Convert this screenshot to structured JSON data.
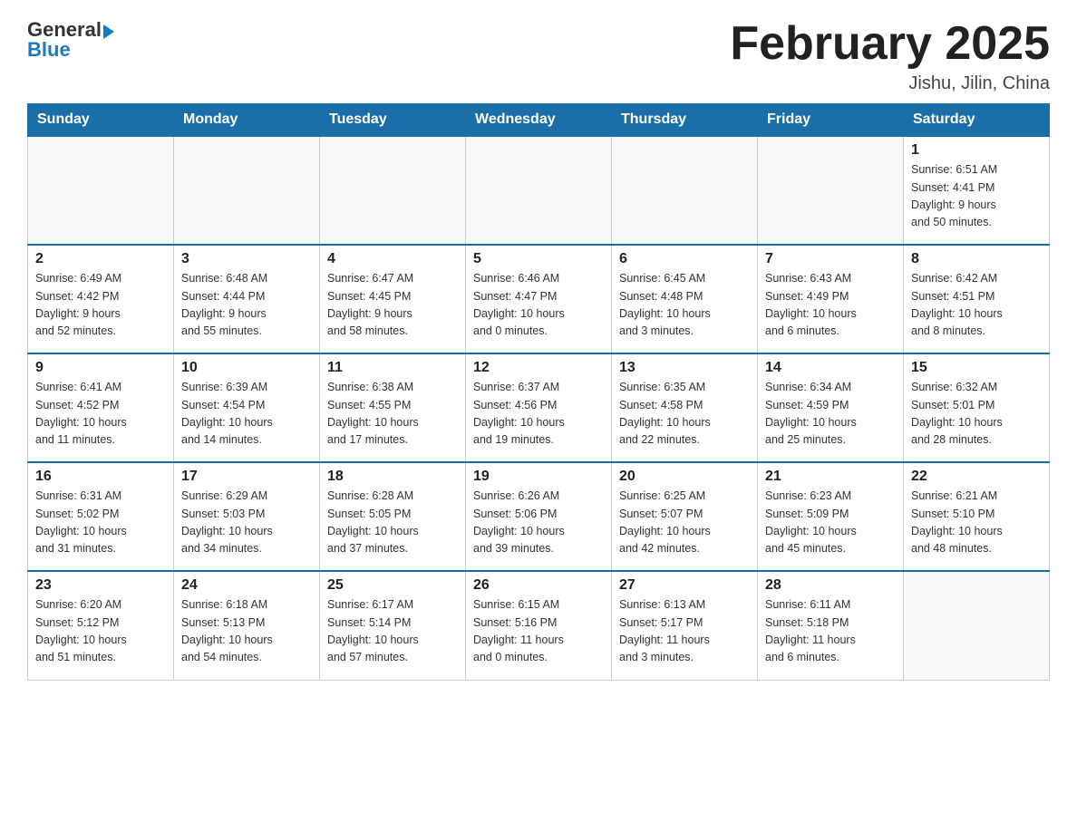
{
  "header": {
    "logo_general": "General",
    "logo_blue": "Blue",
    "title": "February 2025",
    "subtitle": "Jishu, Jilin, China"
  },
  "days_of_week": [
    "Sunday",
    "Monday",
    "Tuesday",
    "Wednesday",
    "Thursday",
    "Friday",
    "Saturday"
  ],
  "weeks": [
    [
      {
        "day": "",
        "info": ""
      },
      {
        "day": "",
        "info": ""
      },
      {
        "day": "",
        "info": ""
      },
      {
        "day": "",
        "info": ""
      },
      {
        "day": "",
        "info": ""
      },
      {
        "day": "",
        "info": ""
      },
      {
        "day": "1",
        "info": "Sunrise: 6:51 AM\nSunset: 4:41 PM\nDaylight: 9 hours\nand 50 minutes."
      }
    ],
    [
      {
        "day": "2",
        "info": "Sunrise: 6:49 AM\nSunset: 4:42 PM\nDaylight: 9 hours\nand 52 minutes."
      },
      {
        "day": "3",
        "info": "Sunrise: 6:48 AM\nSunset: 4:44 PM\nDaylight: 9 hours\nand 55 minutes."
      },
      {
        "day": "4",
        "info": "Sunrise: 6:47 AM\nSunset: 4:45 PM\nDaylight: 9 hours\nand 58 minutes."
      },
      {
        "day": "5",
        "info": "Sunrise: 6:46 AM\nSunset: 4:47 PM\nDaylight: 10 hours\nand 0 minutes."
      },
      {
        "day": "6",
        "info": "Sunrise: 6:45 AM\nSunset: 4:48 PM\nDaylight: 10 hours\nand 3 minutes."
      },
      {
        "day": "7",
        "info": "Sunrise: 6:43 AM\nSunset: 4:49 PM\nDaylight: 10 hours\nand 6 minutes."
      },
      {
        "day": "8",
        "info": "Sunrise: 6:42 AM\nSunset: 4:51 PM\nDaylight: 10 hours\nand 8 minutes."
      }
    ],
    [
      {
        "day": "9",
        "info": "Sunrise: 6:41 AM\nSunset: 4:52 PM\nDaylight: 10 hours\nand 11 minutes."
      },
      {
        "day": "10",
        "info": "Sunrise: 6:39 AM\nSunset: 4:54 PM\nDaylight: 10 hours\nand 14 minutes."
      },
      {
        "day": "11",
        "info": "Sunrise: 6:38 AM\nSunset: 4:55 PM\nDaylight: 10 hours\nand 17 minutes."
      },
      {
        "day": "12",
        "info": "Sunrise: 6:37 AM\nSunset: 4:56 PM\nDaylight: 10 hours\nand 19 minutes."
      },
      {
        "day": "13",
        "info": "Sunrise: 6:35 AM\nSunset: 4:58 PM\nDaylight: 10 hours\nand 22 minutes."
      },
      {
        "day": "14",
        "info": "Sunrise: 6:34 AM\nSunset: 4:59 PM\nDaylight: 10 hours\nand 25 minutes."
      },
      {
        "day": "15",
        "info": "Sunrise: 6:32 AM\nSunset: 5:01 PM\nDaylight: 10 hours\nand 28 minutes."
      }
    ],
    [
      {
        "day": "16",
        "info": "Sunrise: 6:31 AM\nSunset: 5:02 PM\nDaylight: 10 hours\nand 31 minutes."
      },
      {
        "day": "17",
        "info": "Sunrise: 6:29 AM\nSunset: 5:03 PM\nDaylight: 10 hours\nand 34 minutes."
      },
      {
        "day": "18",
        "info": "Sunrise: 6:28 AM\nSunset: 5:05 PM\nDaylight: 10 hours\nand 37 minutes."
      },
      {
        "day": "19",
        "info": "Sunrise: 6:26 AM\nSunset: 5:06 PM\nDaylight: 10 hours\nand 39 minutes."
      },
      {
        "day": "20",
        "info": "Sunrise: 6:25 AM\nSunset: 5:07 PM\nDaylight: 10 hours\nand 42 minutes."
      },
      {
        "day": "21",
        "info": "Sunrise: 6:23 AM\nSunset: 5:09 PM\nDaylight: 10 hours\nand 45 minutes."
      },
      {
        "day": "22",
        "info": "Sunrise: 6:21 AM\nSunset: 5:10 PM\nDaylight: 10 hours\nand 48 minutes."
      }
    ],
    [
      {
        "day": "23",
        "info": "Sunrise: 6:20 AM\nSunset: 5:12 PM\nDaylight: 10 hours\nand 51 minutes."
      },
      {
        "day": "24",
        "info": "Sunrise: 6:18 AM\nSunset: 5:13 PM\nDaylight: 10 hours\nand 54 minutes."
      },
      {
        "day": "25",
        "info": "Sunrise: 6:17 AM\nSunset: 5:14 PM\nDaylight: 10 hours\nand 57 minutes."
      },
      {
        "day": "26",
        "info": "Sunrise: 6:15 AM\nSunset: 5:16 PM\nDaylight: 11 hours\nand 0 minutes."
      },
      {
        "day": "27",
        "info": "Sunrise: 6:13 AM\nSunset: 5:17 PM\nDaylight: 11 hours\nand 3 minutes."
      },
      {
        "day": "28",
        "info": "Sunrise: 6:11 AM\nSunset: 5:18 PM\nDaylight: 11 hours\nand 6 minutes."
      },
      {
        "day": "",
        "info": ""
      }
    ]
  ]
}
